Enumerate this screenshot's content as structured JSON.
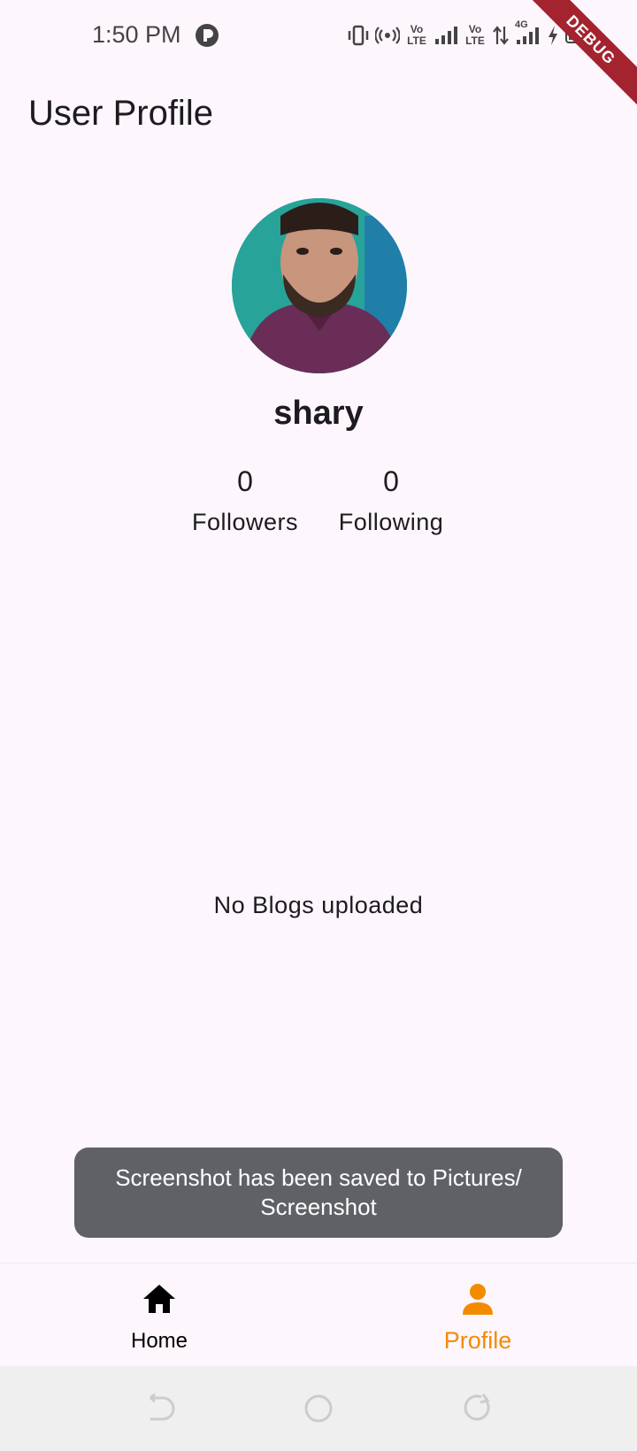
{
  "status_bar": {
    "time": "1:50 PM",
    "icons": [
      "vibrate-icon",
      "hotspot-icon",
      "volte-icon",
      "signal-icon",
      "volte-icon",
      "data-arrows-icon",
      "signal-4g-icon",
      "charging-icon",
      "battery-icon"
    ],
    "volte_label": "Vo LTE",
    "network_label": "4G"
  },
  "debug_banner": "DEBUG",
  "header": {
    "title": "User Profile"
  },
  "profile": {
    "username": "shary",
    "followers_count": "0",
    "followers_label": "Followers",
    "following_count": "0",
    "following_label": "Following"
  },
  "blogs": {
    "empty_message": "No Blogs uploaded"
  },
  "toast": {
    "message": "Screenshot has been saved to  Pictures/ Screenshot"
  },
  "bottom_nav": {
    "items": [
      {
        "label": "Home",
        "icon": "home-icon",
        "active": false
      },
      {
        "label": "Profile",
        "icon": "person-icon",
        "active": true
      }
    ],
    "active_color": "#f38b00"
  },
  "system_nav": {
    "icons": [
      "back-icon",
      "home-circle-icon",
      "recents-icon"
    ]
  }
}
